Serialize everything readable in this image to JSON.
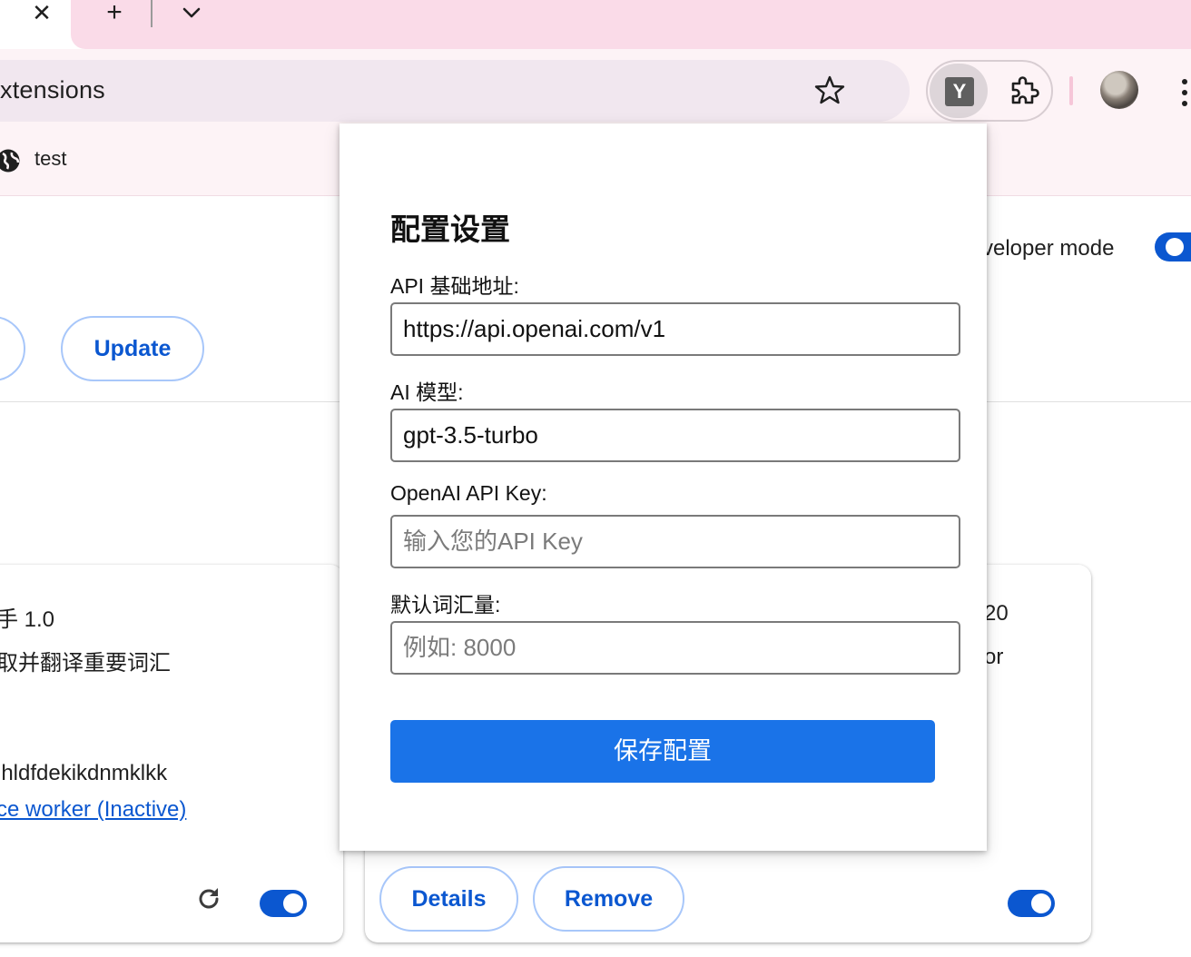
{
  "tabstrip": {
    "close_glyph": "✕",
    "new_tab_glyph": "+",
    "tab_list_icon": "chevron-down-icon"
  },
  "toolbar": {
    "address_text": "xtensions",
    "bookmark_icon": "star-icon",
    "pinned_extension_letter": "Y",
    "extensions_icon": "puzzle-icon",
    "menu_icon": "vertical-dots-icon"
  },
  "bookmarks": {
    "items": [
      {
        "label": "test",
        "icon": "globe-icon"
      }
    ]
  },
  "extensions_page": {
    "developer_mode_label": "veloper mode",
    "developer_mode_on": true,
    "update_button": "Update",
    "accent_color": "#0b57d0",
    "cards": [
      {
        "name_line": "手  1.0",
        "description": "取并翻译重要词汇",
        "id": "jhldfdekikdnmklkk",
        "inspect_link": "ce worker (Inactive)",
        "enabled": true
      },
      {
        "version_fragment": "20",
        "desc_fragment": "or",
        "details_button": "Details",
        "remove_button": "Remove",
        "enabled": true
      }
    ]
  },
  "popup": {
    "title": "配置设置",
    "fields": [
      {
        "label": "API 基础地址:",
        "value": "https://api.openai.com/v1",
        "placeholder": ""
      },
      {
        "label": "AI 模型:",
        "value": "gpt-3.5-turbo",
        "placeholder": ""
      },
      {
        "label": "OpenAI API Key:",
        "value": "",
        "placeholder": "输入您的API Key"
      },
      {
        "label": "默认词汇量:",
        "value": "",
        "placeholder": "例如: 8000"
      }
    ],
    "save_button": "保存配置",
    "button_color": "#1a73e8"
  }
}
